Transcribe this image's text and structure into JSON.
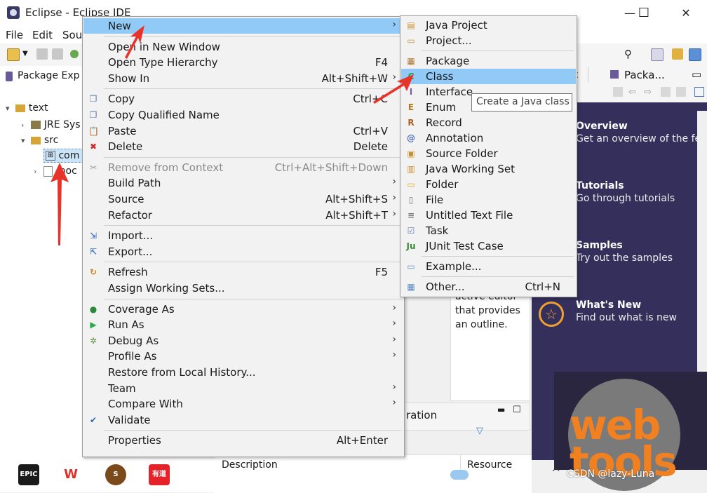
{
  "window": {
    "title": "Eclipse - Eclipse IDE",
    "minimize": "—",
    "maximize": "☐",
    "close": "✕"
  },
  "menubar": [
    "File",
    "Edit",
    "Sou"
  ],
  "explorer": {
    "tab_title": "Package Exp",
    "tree": {
      "project": "text",
      "jre": "JRE Sys",
      "src": "src",
      "pkg": "com",
      "file": "moc"
    }
  },
  "right_tabs": [
    "Packa..."
  ],
  "welcome": {
    "items": [
      {
        "title": "Overview",
        "sub": "Get an overview of the fe"
      },
      {
        "title": "Tutorials",
        "sub": "Go through tutorials"
      },
      {
        "title": "Samples",
        "sub": "Try out the samples"
      },
      {
        "title": "What's New",
        "sub": "Find out what is new"
      }
    ],
    "logo_text": [
      "web",
      "tools"
    ]
  },
  "outline": {
    "lines": [
      "active editor",
      "that provides",
      "an outline."
    ]
  },
  "problems": {
    "tab_partial": "ration",
    "col_description": "Description",
    "col_resource": "Resource"
  },
  "taskbar": {
    "apps": [
      {
        "name": "epic-games",
        "label": "EPIC",
        "color": "#1a1a1a"
      },
      {
        "name": "wps",
        "label": "W",
        "color": "#e0302a"
      },
      {
        "name": "snake-game",
        "label": "S",
        "color": "#7a4a1a"
      },
      {
        "name": "youdao",
        "label": "有道",
        "color": "#e5222a"
      }
    ],
    "watermark": "CSDN @lazy-Luna"
  },
  "context_menu": {
    "items": [
      {
        "label": "New",
        "accel": "",
        "submenu": true,
        "highlight": true,
        "icon": ""
      },
      {
        "sep": true
      },
      {
        "label": "Open in New Window",
        "accel": "",
        "icon": ""
      },
      {
        "label": "Open Type Hierarchy",
        "accel": "F4",
        "icon": ""
      },
      {
        "label": "Show In",
        "accel": "Alt+Shift+W",
        "submenu": true,
        "icon": ""
      },
      {
        "sep": true
      },
      {
        "label": "Copy",
        "accel": "Ctrl+C",
        "icon": "copy"
      },
      {
        "label": "Copy Qualified Name",
        "accel": "",
        "icon": "copy"
      },
      {
        "label": "Paste",
        "accel": "Ctrl+V",
        "icon": "paste"
      },
      {
        "label": "Delete",
        "accel": "Delete",
        "icon": "delete"
      },
      {
        "sep": true
      },
      {
        "label": "Remove from Context",
        "accel": "Ctrl+Alt+Shift+Down",
        "disabled": true,
        "icon": "remove"
      },
      {
        "label": "Build Path",
        "accel": "",
        "submenu": true,
        "icon": ""
      },
      {
        "label": "Source",
        "accel": "Alt+Shift+S",
        "submenu": true,
        "icon": ""
      },
      {
        "label": "Refactor",
        "accel": "Alt+Shift+T",
        "submenu": true,
        "icon": ""
      },
      {
        "sep": true
      },
      {
        "label": "Import...",
        "accel": "",
        "icon": "import"
      },
      {
        "label": "Export...",
        "accel": "",
        "icon": "export"
      },
      {
        "sep": true
      },
      {
        "label": "Refresh",
        "accel": "F5",
        "icon": "refresh"
      },
      {
        "label": "Assign Working Sets...",
        "accel": "",
        "icon": ""
      },
      {
        "sep": true
      },
      {
        "label": "Coverage As",
        "accel": "",
        "submenu": true,
        "icon": "coverage"
      },
      {
        "label": "Run As",
        "accel": "",
        "submenu": true,
        "icon": "run"
      },
      {
        "label": "Debug As",
        "accel": "",
        "submenu": true,
        "icon": "debug"
      },
      {
        "label": "Profile As",
        "accel": "",
        "submenu": true,
        "icon": ""
      },
      {
        "label": "Restore from Local History...",
        "accel": "",
        "icon": ""
      },
      {
        "label": "Team",
        "accel": "",
        "submenu": true,
        "icon": ""
      },
      {
        "label": "Compare With",
        "accel": "",
        "submenu": true,
        "icon": ""
      },
      {
        "label": "Validate",
        "accel": "",
        "icon": "check"
      },
      {
        "sep": true
      },
      {
        "label": "Properties",
        "accel": "Alt+Enter",
        "icon": ""
      }
    ]
  },
  "new_menu": {
    "items": [
      {
        "label": "Java Project",
        "accel": "",
        "icon": "java-project"
      },
      {
        "label": "Project...",
        "accel": "",
        "icon": "project"
      },
      {
        "sep": true
      },
      {
        "label": "Package",
        "accel": "",
        "icon": "package"
      },
      {
        "label": "Class",
        "accel": "",
        "icon": "class",
        "highlight": true
      },
      {
        "label": "Interface",
        "accel": "",
        "icon": "interface"
      },
      {
        "label": "Enum",
        "accel": "",
        "icon": "enum"
      },
      {
        "label": "Record",
        "accel": "",
        "icon": "record"
      },
      {
        "label": "Annotation",
        "accel": "",
        "icon": "annotation"
      },
      {
        "label": "Source Folder",
        "accel": "",
        "icon": "source-folder"
      },
      {
        "label": "Java Working Set",
        "accel": "",
        "icon": "working-set"
      },
      {
        "label": "Folder",
        "accel": "",
        "icon": "folder"
      },
      {
        "label": "File",
        "accel": "",
        "icon": "file"
      },
      {
        "label": "Untitled Text File",
        "accel": "",
        "icon": "text-file"
      },
      {
        "label": "Task",
        "accel": "",
        "icon": "task"
      },
      {
        "label": "JUnit Test Case",
        "accel": "",
        "icon": "junit"
      },
      {
        "sep": true
      },
      {
        "label": "Example...",
        "accel": "",
        "icon": "example"
      },
      {
        "sep": true
      },
      {
        "label": "Other...",
        "accel": "Ctrl+N",
        "icon": "other"
      }
    ]
  },
  "tooltip": "Create a Java class",
  "colors": {
    "highlight": "#91c9f7",
    "welcome_bg": "#352f5c",
    "arrow": "#e8332a"
  }
}
